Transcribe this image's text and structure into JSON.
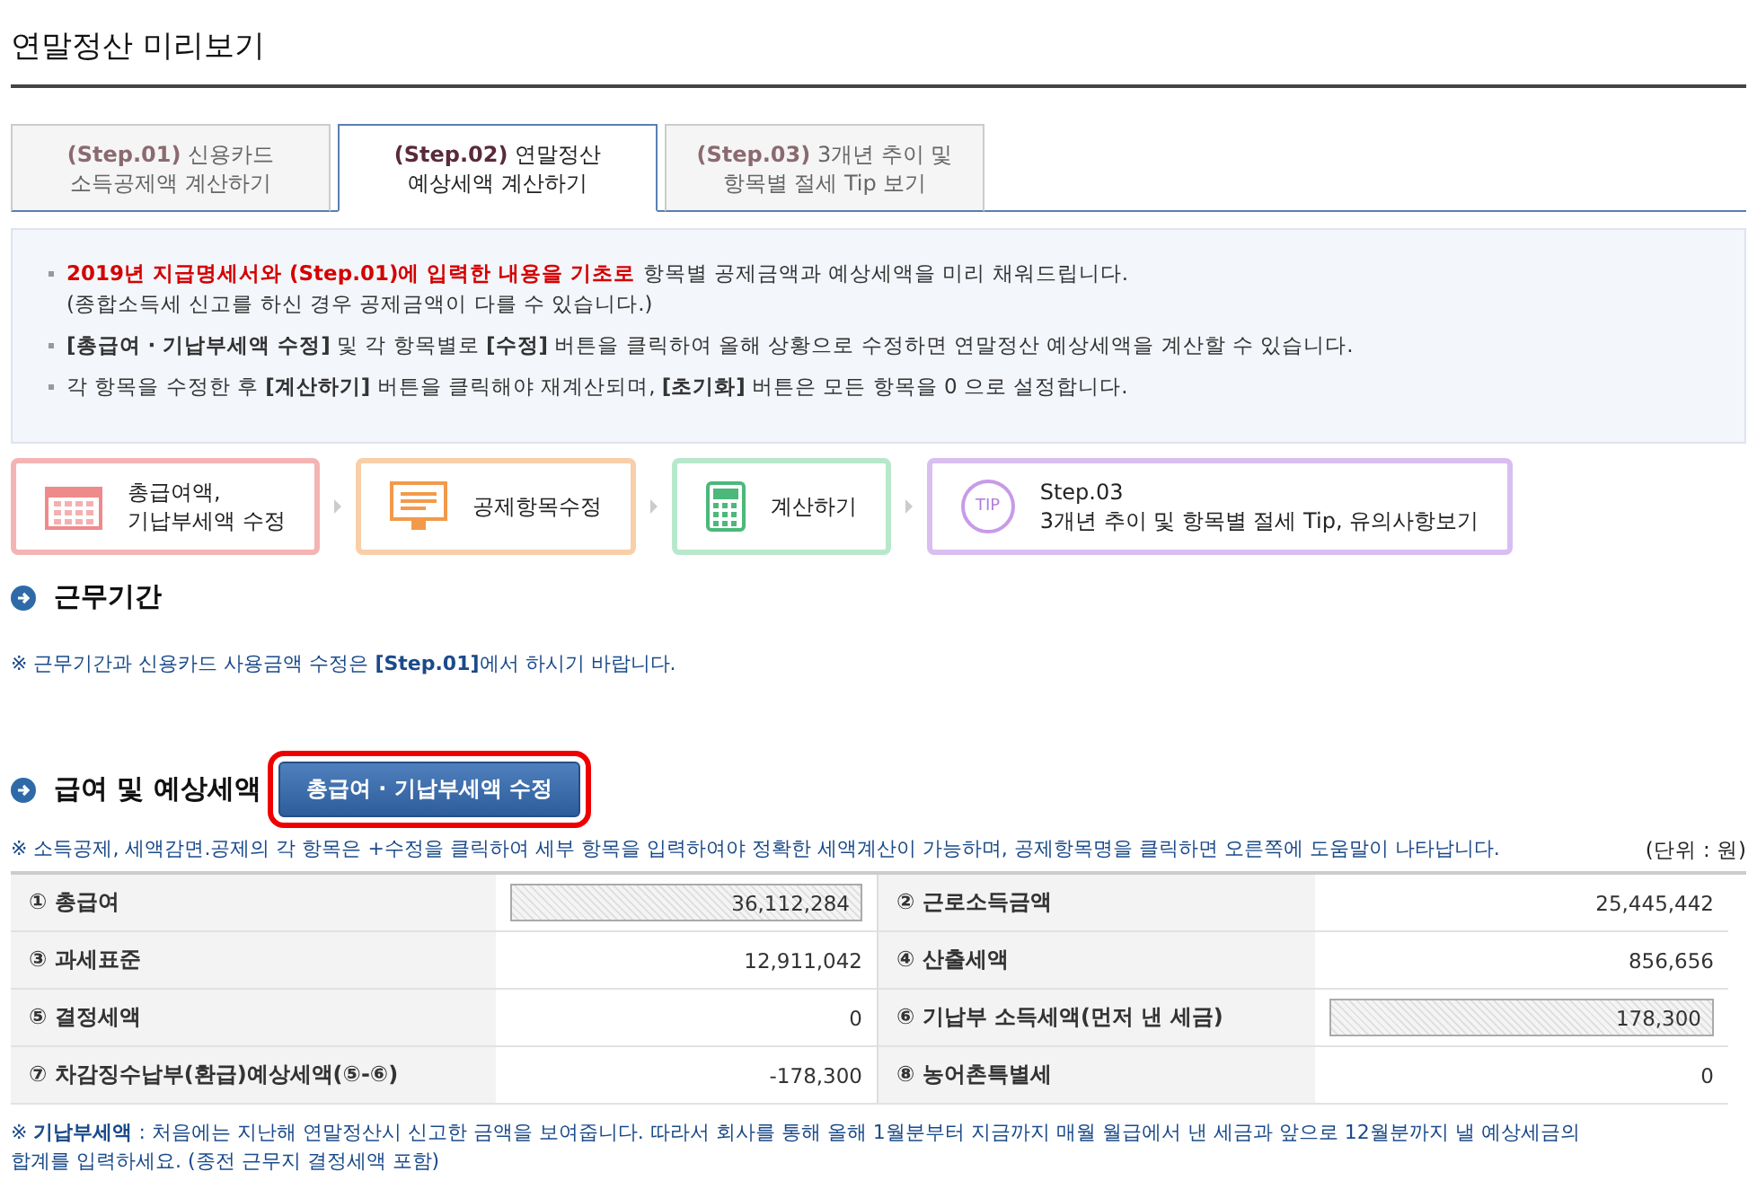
{
  "page_title": "연말정산 미리보기",
  "tabs": [
    {
      "step": "(Step.01)",
      "label": "신용카드\n소득공제액 계산하기",
      "selected": false
    },
    {
      "step": "(Step.02)",
      "label": "연말정산\n예상세액 계산하기",
      "selected": true
    },
    {
      "step": "(Step.03)",
      "label": "3개년 추이 및\n항목별 절세 Tip 보기",
      "selected": false
    }
  ],
  "notice": [
    {
      "lead": "2019년 지급명세서와 (Step.01)에 입력한 내용을 기초로",
      "text": "항목별 공제금액과 예상세액을 미리 채워드립니다.",
      "sub": "(종합소득세 신고를 하신 경우 공제금액이 다를 수 있습니다.)"
    },
    {
      "text": "**[총급여 · 기납부세액 수정]** 및 각 항목별로 **[수정]** 버튼을 클릭하여 올해 상황으로 수정하면 연말정산 예상세액을 계산할 수 있습니다."
    },
    {
      "text": "각 항목을 수정한 후 **[계산하기]** 버튼을 클릭해야 재계산되며, **[초기화]** 버튼은 모든 항목을 0 으로 설정합니다."
    }
  ],
  "steps": [
    {
      "kind": "calendar",
      "color": "#f4b4b4",
      "label": "총급여액,\n기납부세액 수정"
    },
    {
      "kind": "monitor",
      "color": "#f8cfa8",
      "label": "공제항목수정"
    },
    {
      "kind": "calculator",
      "color": "#b8e8cc",
      "label": "계산하기"
    },
    {
      "kind": "tip",
      "color": "#d8bff0",
      "icon_text": "TIP",
      "label": "Step.03\n3개년 추이 및 항목별 절세 Tip, 유의사항보기"
    }
  ],
  "work_period": {
    "title": "근무기간",
    "note": "※ 근무기간과 신용카드 사용금액 수정은 **[Step.01]**에서 하시기 바랍니다."
  },
  "salary": {
    "title": "급여 및 예상세액",
    "edit_button": "총급여 · 기납부세액 수정",
    "note": "※ 소득공제, 세액감면.공제의 각 항목은 +수정을 클릭하여 세부 항목을 입력하여야 정확한 세액계산이 가능하며, 공제항목명을 클릭하면 오른쪽에 도움말이 나타납니다.",
    "unit": "(단위 : 원)",
    "rows": [
      [
        {
          "label": "① 총급여",
          "value": "36,112,284",
          "kind": "input"
        },
        {
          "label": "② 근로소득금액",
          "value": "25,445,442",
          "kind": "text"
        }
      ],
      [
        {
          "label": "③ 과세표준",
          "value": "12,911,042",
          "kind": "text"
        },
        {
          "label": "④ 산출세액",
          "value": "856,656",
          "kind": "text"
        }
      ],
      [
        {
          "label": "⑤ 결정세액",
          "value": "0",
          "kind": "text"
        },
        {
          "label": "⑥ 기납부 소득세액(먼저 낸 세금)",
          "value": "178,300",
          "kind": "input"
        }
      ],
      [
        {
          "label": "⑦ 차감징수납부(환급)예상세액(⑤-⑥)",
          "value": "-178,300",
          "kind": "text"
        },
        {
          "label": "⑧ 농어촌특별세",
          "value": "0",
          "kind": "text"
        }
      ]
    ],
    "footnote": "※ **기납부세액** : 처음에는 지난해 연말정산시 신고한 금액을 보여줍니다. 따라서 회사를 통해 올해 1월분부터 지금까지 매월 월급에서 낸 세금과 앞으로 12월분까지 낼 예상세금의\n합계를 입력하세요. (종전 근무지 결정세액 포함)"
  }
}
